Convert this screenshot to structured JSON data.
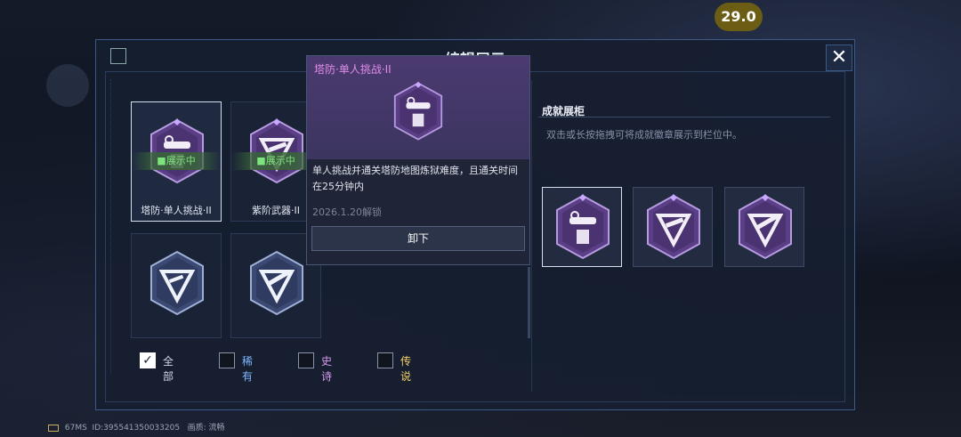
{
  "hud": {
    "fps": "29.0"
  },
  "panel": {
    "title": "编辑展示",
    "close_label": "✕"
  },
  "library": {
    "showing_label": "■展示中",
    "cards": [
      {
        "label": "塔防·单人挑战·II",
        "badge": "tower-badge",
        "selected": true,
        "showing": true
      },
      {
        "label": "紫阶武器·II",
        "badge": "weapon-badge",
        "selected": false,
        "showing": true
      },
      {
        "label": "",
        "badge": "v-badge",
        "selected": false,
        "showing": false
      },
      {
        "label": "",
        "badge": "gun-badge",
        "selected": false,
        "showing": false
      }
    ]
  },
  "tooltip": {
    "title": "塔防·单人挑战·II",
    "description": "单人挑战并通关塔防地图炼狱难度，且通关时间在25分钟内",
    "unlock_date": "2026.1.20解锁",
    "unload_label": "卸下"
  },
  "filters": [
    {
      "label": "全部",
      "checked": true,
      "color": "#ffffff"
    },
    {
      "label": "稀有",
      "checked": false,
      "color": "#7fb6ff"
    },
    {
      "label": "史诗",
      "checked": false,
      "color": "#d79cf0"
    },
    {
      "label": "传说",
      "checked": false,
      "color": "#f3d06a"
    }
  ],
  "cabinet": {
    "title": "成就展柜",
    "description": "双击或长按拖拽可将成就徽章展示到栏位中。",
    "slots": [
      "tower-badge",
      "v-badge",
      "gun-badge"
    ]
  },
  "footer": {
    "ping": "67MS",
    "id": "ID:395541350033205",
    "quality": "画质: 流畅"
  }
}
